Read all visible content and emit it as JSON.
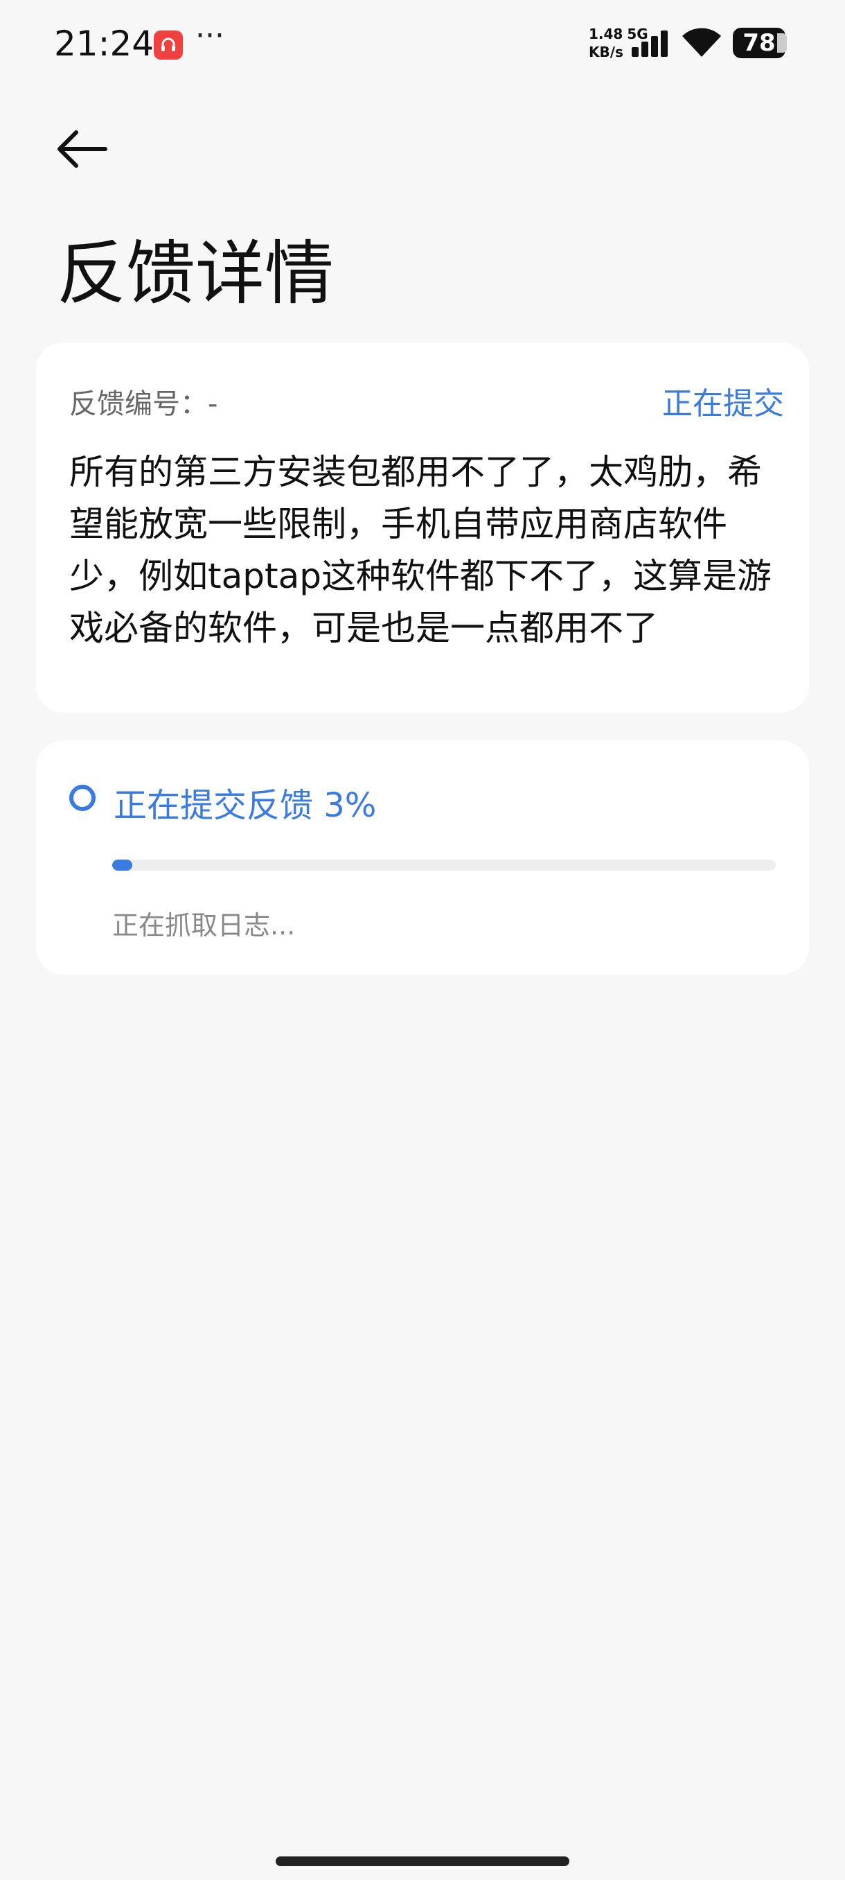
{
  "status_bar": {
    "time": "21:24",
    "net_speed_value": "1.48",
    "net_speed_unit": "KB/s",
    "network_type": "5G",
    "battery": "78",
    "app_badge_icon": "headset-icon",
    "more": "···"
  },
  "header": {
    "title": "反馈详情",
    "back_icon": "arrow-left-icon"
  },
  "feedback": {
    "id_label": "反馈编号：-",
    "status": "正在提交",
    "content": "所有的第三方安装包都用不了了，太鸡肋，希望能放宽一些限制，手机自带应用商店软件少，例如taptap这种软件都下不了，这算是游戏必备的软件，可是也是一点都用不了"
  },
  "submission": {
    "title": "正在提交反馈 3%",
    "progress_percent": 3,
    "subtext": "正在抓取日志..."
  },
  "colors": {
    "accent": "#3a7be0",
    "background": "#f7f7f8",
    "card": "#ffffff"
  }
}
